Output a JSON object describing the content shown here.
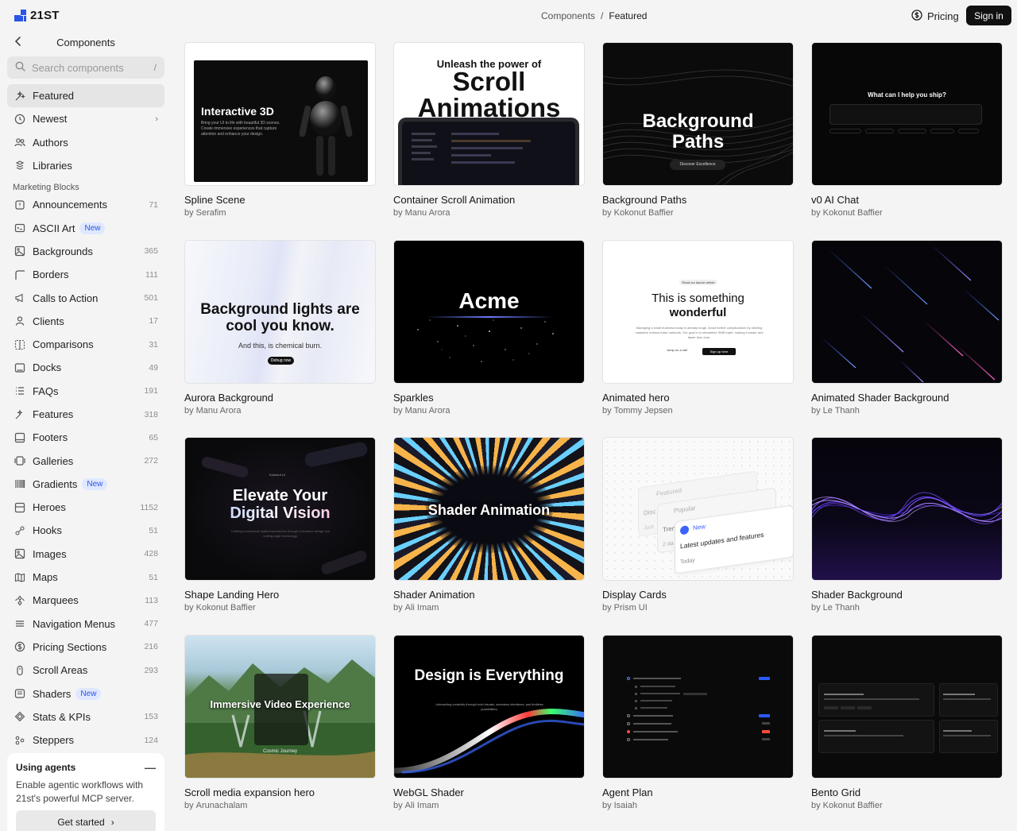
{
  "brand": {
    "name": "21ST"
  },
  "sidebar": {
    "title": "Components",
    "search_placeholder": "Search components",
    "search_shortcut": "/",
    "top_items": [
      {
        "label": "Featured",
        "icon": "sparkles-icon",
        "active": true
      },
      {
        "label": "Newest",
        "icon": "clock-icon",
        "chevron": true
      },
      {
        "label": "Authors",
        "icon": "users-icon"
      },
      {
        "label": "Libraries",
        "icon": "blocks-icon"
      }
    ],
    "section_label": "Marketing Blocks",
    "items": [
      {
        "label": "Announcements",
        "count": "71",
        "icon": "megaphone-box-icon"
      },
      {
        "label": "ASCII Art",
        "badge": "New",
        "icon": "terminal-icon"
      },
      {
        "label": "Backgrounds",
        "count": "365",
        "icon": "image-icon"
      },
      {
        "label": "Borders",
        "count": "111",
        "icon": "corner-icon"
      },
      {
        "label": "Calls to Action",
        "count": "501",
        "icon": "megaphone-icon"
      },
      {
        "label": "Clients",
        "count": "17",
        "icon": "user-icon"
      },
      {
        "label": "Comparisons",
        "count": "31",
        "icon": "compare-icon"
      },
      {
        "label": "Docks",
        "count": "49",
        "icon": "dock-icon"
      },
      {
        "label": "FAQs",
        "count": "191",
        "icon": "list-icon"
      },
      {
        "label": "Features",
        "count": "318",
        "icon": "sparkles-icon"
      },
      {
        "label": "Footers",
        "count": "65",
        "icon": "footer-icon"
      },
      {
        "label": "Galleries",
        "count": "272",
        "icon": "gallery-icon"
      },
      {
        "label": "Gradients",
        "badge": "New",
        "icon": "gradient-icon"
      },
      {
        "label": "Heroes",
        "count": "1152",
        "icon": "hero-icon"
      },
      {
        "label": "Hooks",
        "count": "51",
        "icon": "hook-icon"
      },
      {
        "label": "Images",
        "count": "428",
        "icon": "image-icon"
      },
      {
        "label": "Maps",
        "count": "51",
        "icon": "map-icon"
      },
      {
        "label": "Marquees",
        "count": "113",
        "icon": "marquee-icon"
      },
      {
        "label": "Navigation Menus",
        "count": "477",
        "icon": "menu-icon"
      },
      {
        "label": "Pricing Sections",
        "count": "216",
        "icon": "dollar-icon"
      },
      {
        "label": "Scroll Areas",
        "count": "293",
        "icon": "scroll-icon"
      },
      {
        "label": "Shaders",
        "badge": "New",
        "icon": "shader-icon"
      },
      {
        "label": "Stats & KPIs",
        "count": "153",
        "icon": "stats-icon"
      },
      {
        "label": "Steppers",
        "count": "124",
        "icon": "stepper-icon"
      }
    ],
    "agent_card": {
      "title": "Using agents",
      "text": "Enable agentic workflows with 21st's powerful MCP server.",
      "button": "Get started"
    }
  },
  "header": {
    "breadcrumb": [
      "Components",
      "/",
      "Featured"
    ],
    "pricing": "Pricing",
    "signin": "Sign in"
  },
  "cards": [
    {
      "title": "Spline Scene",
      "by": "by",
      "author": "Serafim",
      "thumb": {
        "heading": "Interactive 3D",
        "sub": "Bring your UI to life with beautiful 3D scenes. Create immersive experiences that capture attention and enhance your design."
      }
    },
    {
      "title": "Container Scroll Animation",
      "by": "by",
      "author": "Manu Arora",
      "thumb": {
        "top": "Unleash the power of",
        "big": "Scroll Animations"
      }
    },
    {
      "title": "Background Paths",
      "by": "by",
      "author": "Kokonut Baffier",
      "thumb": {
        "big": "Background Paths",
        "btn": "Discover Excellence"
      }
    },
    {
      "title": "v0 AI Chat",
      "by": "by",
      "author": "Kokonut Baffier",
      "thumb": {
        "heading": "What can I help you ship?"
      }
    },
    {
      "title": "Aurora Background",
      "by": "by",
      "author": "Manu Arora",
      "thumb": {
        "big": "Background lights are cool you know.",
        "sub": "And this, is chemical burn.",
        "btn": "Debug now"
      }
    },
    {
      "title": "Sparkles",
      "by": "by",
      "author": "Manu Arora",
      "thumb": {
        "big": "Acme"
      }
    },
    {
      "title": "Animated hero",
      "by": "by",
      "author": "Tommy Jepsen",
      "thumb": {
        "pill": "Read our launch article",
        "big1": "This is something",
        "big2": "wonderful",
        "sub": "Managing a small business today is already tough. Avoid further complications by ditching outdated, tedious trade methods. Our goal is to streamline SMB trade, making it easier and faster than ever.",
        "btn1": "Jump on a call",
        "btn2": "Sign up here"
      }
    },
    {
      "title": "Animated Shader Background",
      "by": "by",
      "author": "Le Thanh",
      "thumb": {}
    },
    {
      "title": "Shape Landing Hero",
      "by": "by",
      "author": "Kokonut Baffier",
      "thumb": {
        "pill": "Kokonut UI",
        "big1": "Elevate Your",
        "big2": "Digital Vision",
        "sub": "Crafting exceptional digital experiences through innovative design and cutting-edge technology."
      }
    },
    {
      "title": "Shader Animation",
      "by": "by",
      "author": "Ali Imam",
      "thumb": {
        "big": "Shader Animation"
      }
    },
    {
      "title": "Display Cards",
      "by": "by",
      "author": "Prism UI",
      "thumb": {
        "c1": "Featured",
        "c2": "Popular",
        "c3": "New",
        "c3sub": "Latest updates and features",
        "c3foot": "Today",
        "c1peek": "Disc",
        "c2peek": "Tren",
        "c2peek2": "2 da",
        "c1peek2": "Just"
      }
    },
    {
      "title": "Shader Background",
      "by": "by",
      "author": "Le Thanh",
      "thumb": {}
    },
    {
      "title": "Scroll media expansion hero",
      "by": "by",
      "author": "Arunachalam",
      "thumb": {
        "big": "Immersive Video Experience",
        "sub": "Cosmic Journey"
      }
    },
    {
      "title": "WebGL Shader",
      "by": "by",
      "author": "Ali Imam",
      "thumb": {
        "big": "Design is Everything",
        "sub": "Unleashing creativity through bold visuals, seamless interfaces, and limitless possibilities."
      }
    },
    {
      "title": "Agent Plan",
      "by": "by",
      "author": "Isaiah",
      "thumb": {}
    },
    {
      "title": "Bento Grid",
      "by": "by",
      "author": "Kokonut Baffier",
      "thumb": {}
    }
  ]
}
